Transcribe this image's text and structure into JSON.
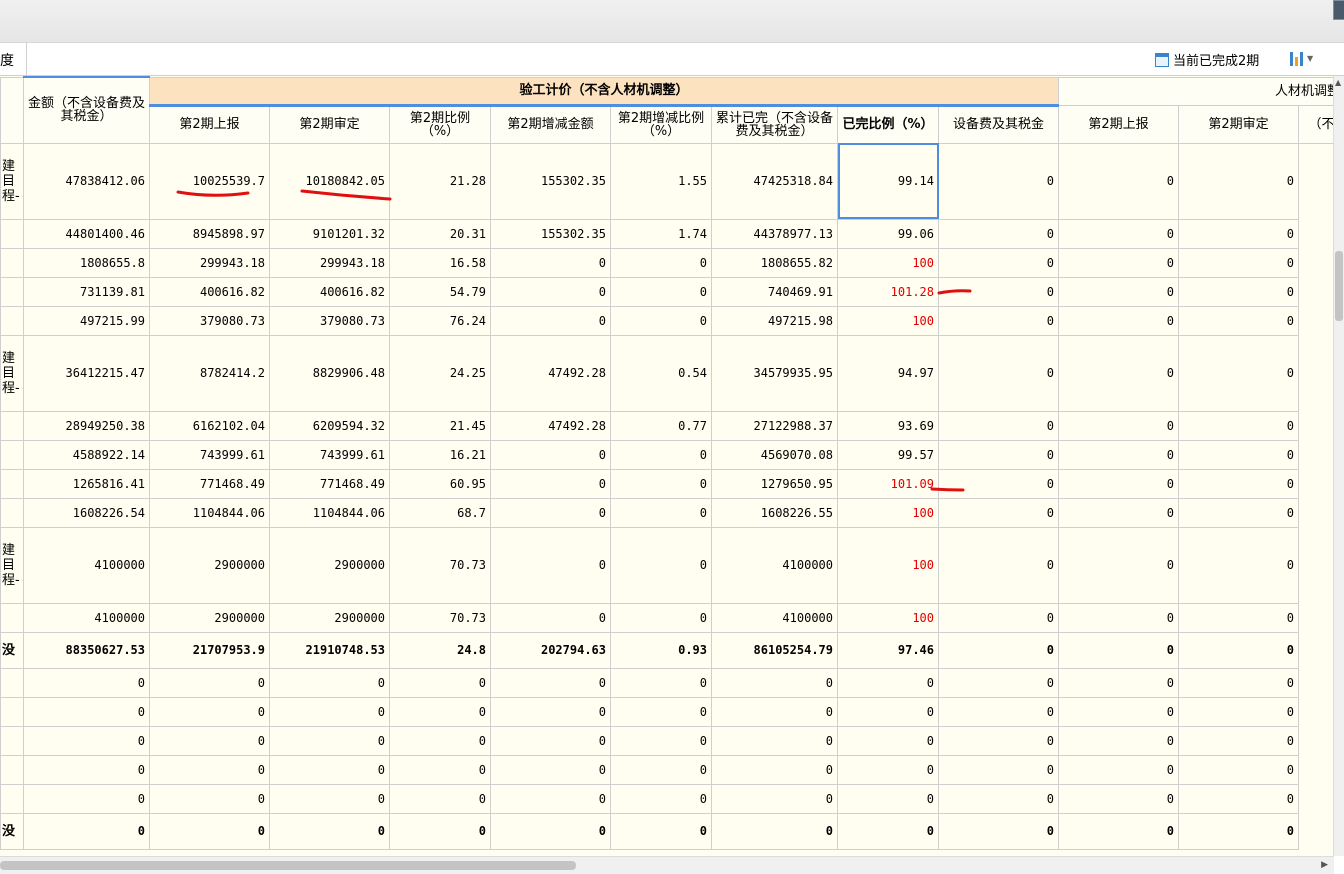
{
  "toolbar": {
    "left_label": "度",
    "period_label": "当前已完成2期"
  },
  "header": {
    "col_amount": "金额（不含设备费及其税金）",
    "group_verification": "验工计价（不含人材机调整）",
    "group_adjust": "人材机调整",
    "sub": [
      "第2期上报",
      "第2期审定",
      "第2期比例（%）",
      "第2期增减金额",
      "第2期增减比例（%）",
      "累计已完（不含设备费及其税金）",
      "已完比例（%）",
      "设备费及其税金",
      "第2期上报",
      "第2期审定",
      "（不"
    ]
  },
  "rows": [
    {
      "label": "建目程-",
      "cells": [
        "47838412.06",
        "10025539.7",
        "10180842.05",
        "21.28",
        "155302.35",
        "1.55",
        "47425318.84",
        "99.14",
        "0",
        "0",
        "0"
      ],
      "kind": "tall",
      "red": false
    },
    {
      "label": "",
      "cells": [
        "44801400.46",
        "8945898.97",
        "9101201.32",
        "20.31",
        "155302.35",
        "1.74",
        "44378977.13",
        "99.06",
        "0",
        "0",
        "0"
      ],
      "kind": "norm",
      "red": false
    },
    {
      "label": "",
      "cells": [
        "1808655.8",
        "299943.18",
        "299943.18",
        "16.58",
        "0",
        "0",
        "1808655.82",
        "100",
        "0",
        "0",
        "0"
      ],
      "kind": "norm",
      "red": true
    },
    {
      "label": "",
      "cells": [
        "731139.81",
        "400616.82",
        "400616.82",
        "54.79",
        "0",
        "0",
        "740469.91",
        "101.28",
        "0",
        "0",
        "0"
      ],
      "kind": "norm",
      "red": true
    },
    {
      "label": "",
      "cells": [
        "497215.99",
        "379080.73",
        "379080.73",
        "76.24",
        "0",
        "0",
        "497215.98",
        "100",
        "0",
        "0",
        "0"
      ],
      "kind": "norm",
      "red": true
    },
    {
      "label": "建目程-",
      "cells": [
        "36412215.47",
        "8782414.2",
        "8829906.48",
        "24.25",
        "47492.28",
        "0.54",
        "34579935.95",
        "94.97",
        "0",
        "0",
        "0"
      ],
      "kind": "tall",
      "red": false
    },
    {
      "label": "",
      "cells": [
        "28949250.38",
        "6162102.04",
        "6209594.32",
        "21.45",
        "47492.28",
        "0.77",
        "27122988.37",
        "93.69",
        "0",
        "0",
        "0"
      ],
      "kind": "norm",
      "red": false
    },
    {
      "label": "",
      "cells": [
        "4588922.14",
        "743999.61",
        "743999.61",
        "16.21",
        "0",
        "0",
        "4569070.08",
        "99.57",
        "0",
        "0",
        "0"
      ],
      "kind": "norm",
      "red": false
    },
    {
      "label": "",
      "cells": [
        "1265816.41",
        "771468.49",
        "771468.49",
        "60.95",
        "0",
        "0",
        "1279650.95",
        "101.09",
        "0",
        "0",
        "0"
      ],
      "kind": "norm",
      "red": true
    },
    {
      "label": "",
      "cells": [
        "1608226.54",
        "1104844.06",
        "1104844.06",
        "68.7",
        "0",
        "0",
        "1608226.55",
        "100",
        "0",
        "0",
        "0"
      ],
      "kind": "norm",
      "red": true
    },
    {
      "label": "建目程-",
      "cells": [
        "4100000",
        "2900000",
        "2900000",
        "70.73",
        "0",
        "0",
        "4100000",
        "100",
        "0",
        "0",
        "0"
      ],
      "kind": "tall",
      "red": true
    },
    {
      "label": "",
      "cells": [
        "4100000",
        "2900000",
        "2900000",
        "70.73",
        "0",
        "0",
        "4100000",
        "100",
        "0",
        "0",
        "0"
      ],
      "kind": "norm",
      "red": true
    },
    {
      "label": "没",
      "cells": [
        "88350627.53",
        "21707953.9",
        "21910748.53",
        "24.8",
        "202794.63",
        "0.93",
        "86105254.79",
        "97.46",
        "0",
        "0",
        "0"
      ],
      "kind": "sum",
      "red": false
    },
    {
      "label": "",
      "cells": [
        "0",
        "0",
        "0",
        "0",
        "0",
        "0",
        "0",
        "0",
        "0",
        "0",
        "0"
      ],
      "kind": "norm",
      "red": false
    },
    {
      "label": "",
      "cells": [
        "0",
        "0",
        "0",
        "0",
        "0",
        "0",
        "0",
        "0",
        "0",
        "0",
        "0"
      ],
      "kind": "norm",
      "red": false
    },
    {
      "label": "",
      "cells": [
        "0",
        "0",
        "0",
        "0",
        "0",
        "0",
        "0",
        "0",
        "0",
        "0",
        "0"
      ],
      "kind": "norm",
      "red": false
    },
    {
      "label": "",
      "cells": [
        "0",
        "0",
        "0",
        "0",
        "0",
        "0",
        "0",
        "0",
        "0",
        "0",
        "0"
      ],
      "kind": "norm",
      "red": false
    },
    {
      "label": "",
      "cells": [
        "0",
        "0",
        "0",
        "0",
        "0",
        "0",
        "0",
        "0",
        "0",
        "0",
        "0"
      ],
      "kind": "norm",
      "red": false
    },
    {
      "label": "没",
      "cells": [
        "0",
        "0",
        "0",
        "0",
        "0",
        "0",
        "0",
        "0",
        "0",
        "0",
        "0"
      ],
      "kind": "sum",
      "red": false
    }
  ],
  "colors": {
    "header_group": "#fde2c0",
    "grid_bg": "#fffef0",
    "accent": "#4f8ede",
    "warn": "#e00000"
  }
}
